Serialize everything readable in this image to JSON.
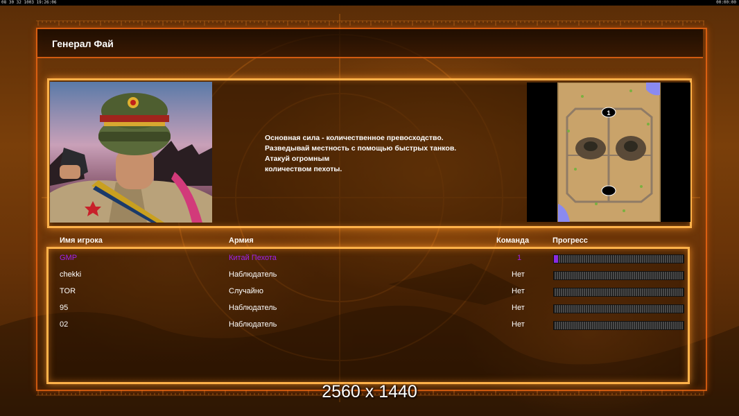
{
  "top_strip": {
    "left_text": "08 30 32 1003  19:26:06",
    "right_text": "00:00:00"
  },
  "title": "Генерал Фай",
  "briefing_lines": [
    "Основная сила - количественное превосходство.",
    "Разведывай местность с помощью быстрых танков.",
    "Атакуй огромным",
    "количеством пехоты."
  ],
  "minimap": {
    "start_positions": [
      "1",
      ""
    ]
  },
  "columns": {
    "player": "Имя игрока",
    "army": "Армия",
    "team": "Команда",
    "progress": "Прогресс"
  },
  "players": [
    {
      "name": "GMP",
      "army": "Китай Пехота",
      "team": "1",
      "progress": 0.03,
      "own": true
    },
    {
      "name": "chekki",
      "army": "Наблюдатель",
      "team": "Нет",
      "progress": 0
    },
    {
      "name": "TOR",
      "army": "Случайно",
      "team": "Нет",
      "progress": 0
    },
    {
      "name": "95",
      "army": "Наблюдатель",
      "team": "Нет",
      "progress": 0
    },
    {
      "name": "02",
      "army": "Наблюдатель",
      "team": "Нет",
      "progress": 0
    }
  ],
  "overlay_caption": "2560 x 1440",
  "colors": {
    "accent": "#ffb24a",
    "frame": "#ff6e14",
    "own_player": "#a020f0",
    "background": "#6a3408"
  }
}
